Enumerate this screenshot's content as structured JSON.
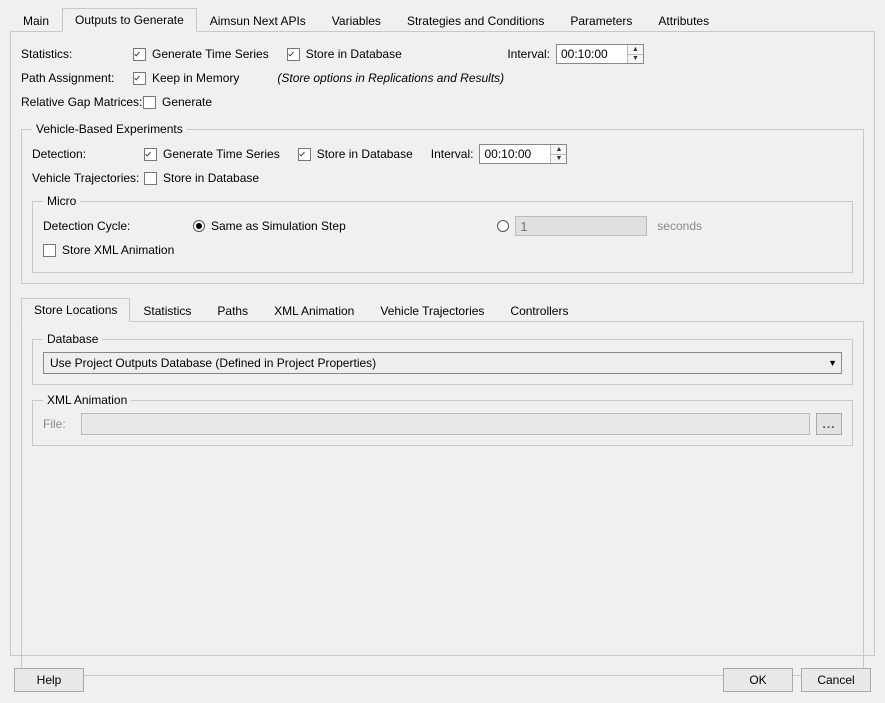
{
  "top_tabs": {
    "main": "Main",
    "outputs": "Outputs to Generate",
    "apis": "Aimsun Next APIs",
    "vars": "Variables",
    "strat": "Strategies and Conditions",
    "params": "Parameters",
    "attrs": "Attributes"
  },
  "stats_section": {
    "label": "Statistics:",
    "gen_time_series": "Generate Time Series",
    "store_db": "Store in Database",
    "interval_lbl": "Interval:",
    "interval_val": "00:10:00"
  },
  "path_assign": {
    "label": "Path Assignment:",
    "keep_mem": "Keep in Memory",
    "note": "(Store options in Replications and Results)"
  },
  "rel_gap": {
    "label": "Relative Gap Matrices:",
    "generate": "Generate"
  },
  "veh_exp": {
    "legend": "Vehicle-Based Experiments",
    "detection_lbl": "Detection:",
    "gen_time_series": "Generate Time Series",
    "store_db": "Store in Database",
    "interval_lbl": "Interval:",
    "interval_val": "00:10:00",
    "traj_lbl": "Vehicle Trajectories:",
    "traj_store_db": "Store in Database"
  },
  "micro": {
    "legend": "Micro",
    "cycle_lbl": "Detection Cycle:",
    "same_step": "Same as Simulation Step",
    "custom_val": "1",
    "seconds": "seconds",
    "store_xml_anim": "Store XML Animation"
  },
  "inner_tabs": {
    "store_loc": "Store Locations",
    "stats": "Statistics",
    "paths": "Paths",
    "xml_anim": "XML Animation",
    "veh_traj": "Vehicle Trajectories",
    "controllers": "Controllers"
  },
  "database": {
    "legend": "Database",
    "combo_value": "Use Project Outputs Database (Defined in Project Properties)"
  },
  "xml_anim_group": {
    "legend": "XML Animation",
    "file_lbl": "File:",
    "browse": "..."
  },
  "footer": {
    "help": "Help",
    "ok": "OK",
    "cancel": "Cancel"
  }
}
